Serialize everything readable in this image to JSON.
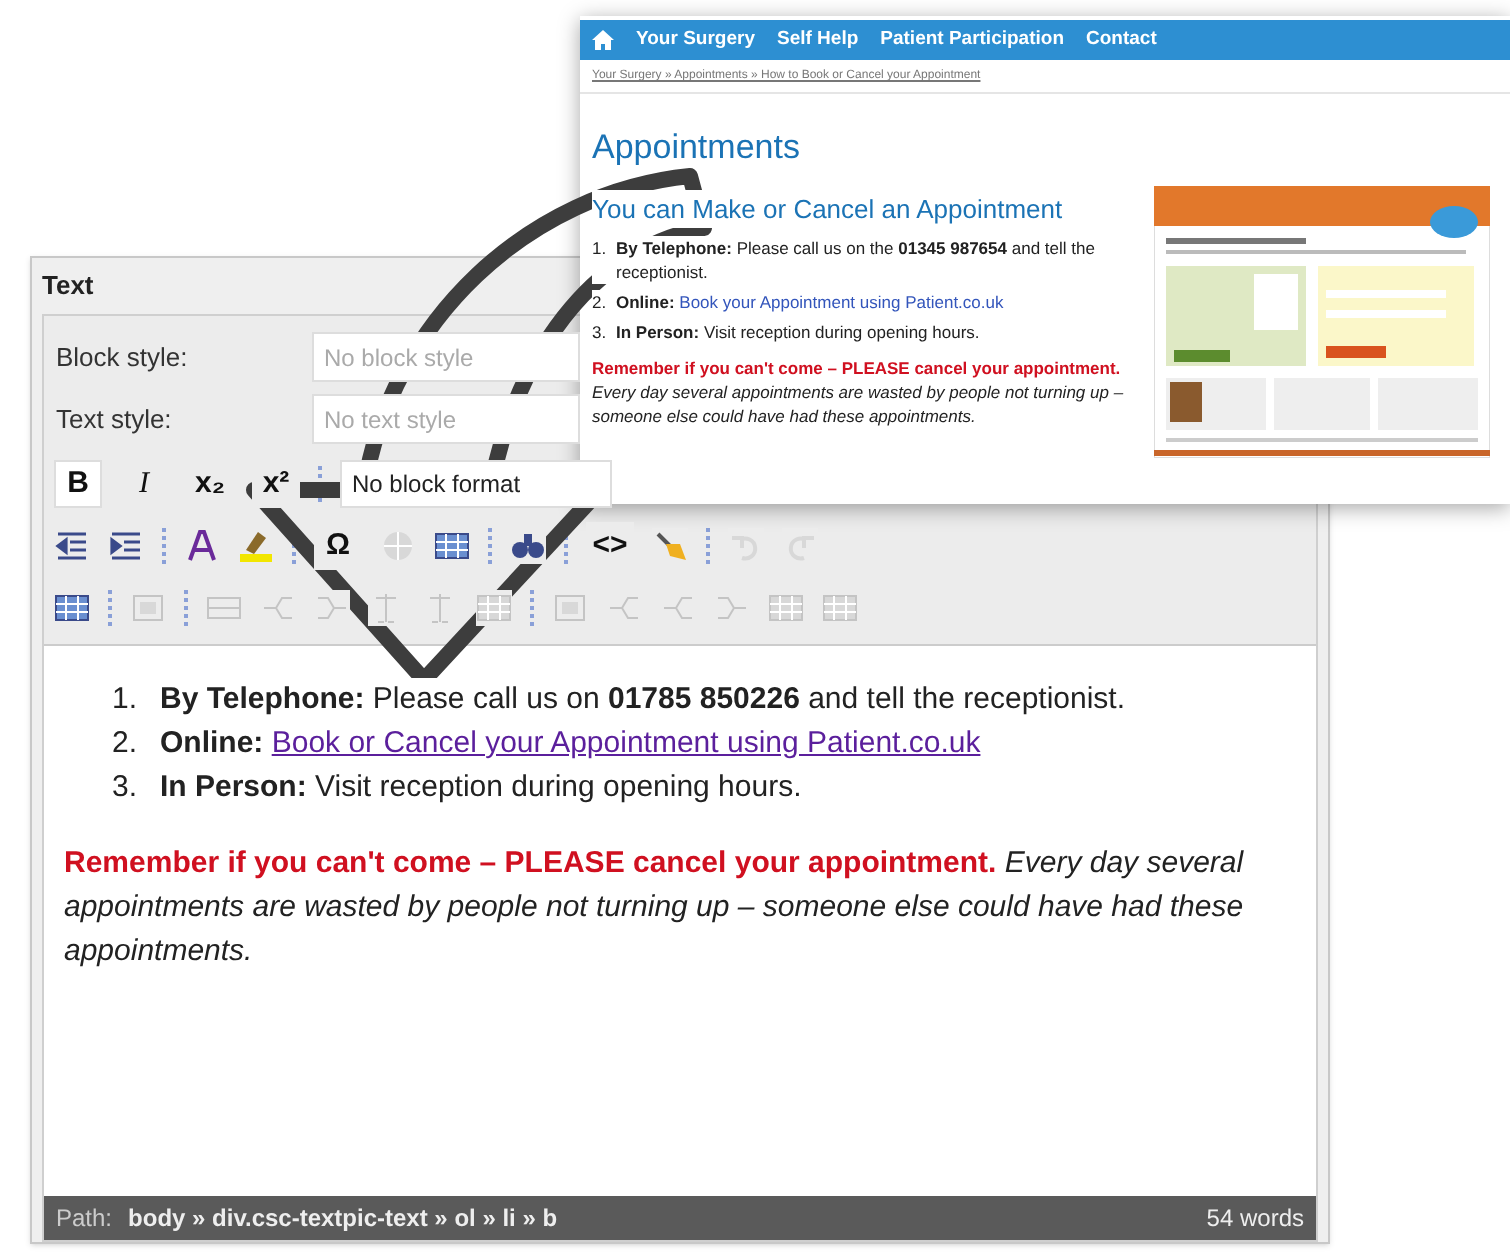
{
  "popup": {
    "nav_items": [
      "Your Surgery",
      "Self Help",
      "Patient Participation",
      "Contact"
    ],
    "breadcrumb": "Your Surgery » Appointments » How to Book or Cancel your Appointment",
    "title": "Appointments",
    "heading": "You can Make or Cancel an Appointment",
    "list": [
      {
        "number": "1.",
        "label": "By Telephone:",
        "kind": "text",
        "text": "Please call us on the **01345 987654** and tell the receptionist."
      },
      {
        "number": "2.",
        "label": "Online:",
        "kind": "link",
        "text": "Book your Appointment using Patient.co.uk"
      },
      {
        "number": "3.",
        "label": "In Person:",
        "kind": "text",
        "text": "Visit reception during opening hours."
      }
    ],
    "warning": "Remember if you can't come – PLEASE cancel your appointment.",
    "note": "Every day several appointments are wasted by people not turning up – someone else could have had these appointments."
  },
  "editor": {
    "title": "Text",
    "fields": [
      {
        "label": "Block style:",
        "placeholder": "No block style"
      },
      {
        "label": "Text style:",
        "placeholder": "No text style"
      }
    ],
    "toolbar_rows": [
      [
        {
          "kind": "bold",
          "label": "B",
          "active": true
        },
        {
          "kind": "italic",
          "label": "I",
          "active": false
        },
        {
          "kind": "subscript",
          "label": "x₂",
          "active": false
        },
        {
          "kind": "superscript",
          "label": "x²",
          "active": false
        },
        {
          "kind": "separator"
        },
        {
          "kind": "select",
          "value": "No block format"
        }
      ],
      [
        {
          "kind": "outdent",
          "disabled": false
        },
        {
          "kind": "indent",
          "disabled": false
        },
        {
          "kind": "separator"
        },
        {
          "kind": "text-color",
          "disabled": false
        },
        {
          "kind": "highlight",
          "disabled": false
        },
        {
          "kind": "separator"
        },
        {
          "kind": "symbol",
          "label": "Ω",
          "active": false
        },
        {
          "kind": "globe",
          "disabled": true
        },
        {
          "kind": "table",
          "disabled": false
        },
        {
          "kind": "separator"
        },
        {
          "kind": "find",
          "disabled": false
        },
        {
          "kind": "separator"
        },
        {
          "kind": "source",
          "label": "<>",
          "active": false
        },
        {
          "kind": "broom",
          "disabled": false
        },
        {
          "kind": "separator"
        },
        {
          "kind": "undo",
          "disabled": true
        },
        {
          "kind": "redo",
          "disabled": true
        }
      ],
      [
        {
          "kind": "table",
          "disabled": false
        },
        {
          "kind": "separator"
        },
        {
          "kind": "cell",
          "disabled": true
        },
        {
          "kind": "separator"
        },
        {
          "kind": "row",
          "disabled": true
        },
        {
          "kind": "split",
          "disabled": true
        },
        {
          "kind": "merge",
          "disabled": true
        },
        {
          "kind": "columns",
          "disabled": true
        },
        {
          "kind": "columns",
          "disabled": true
        },
        {
          "kind": "table",
          "disabled": true
        },
        {
          "kind": "separator"
        },
        {
          "kind": "cell",
          "disabled": true
        },
        {
          "kind": "split",
          "disabled": true
        },
        {
          "kind": "split",
          "disabled": true
        },
        {
          "kind": "merge",
          "disabled": true
        },
        {
          "kind": "table",
          "disabled": true
        },
        {
          "kind": "table",
          "disabled": true
        }
      ]
    ],
    "list": [
      {
        "number": "1.",
        "label": "By Telephone:",
        "kind": "text",
        "text": "Please call us on **01785 850226** and tell the receptionist."
      },
      {
        "number": "2.",
        "label": "Online:",
        "kind": "link",
        "text": "Book or Cancel your Appointment using Patient.co.uk"
      },
      {
        "number": "3.",
        "label": "In Person:",
        "kind": "text",
        "text": "Visit reception during opening hours."
      }
    ],
    "warning": "Remember if you can't come – PLEASE cancel your appointment.",
    "note": "Every day several appointments are wasted by people not turning up – someone else could have had these appointments.",
    "status": {
      "label": "Path:",
      "path": "body » div.csc-textpic-text » ol » li » b",
      "count": "54 words"
    }
  }
}
